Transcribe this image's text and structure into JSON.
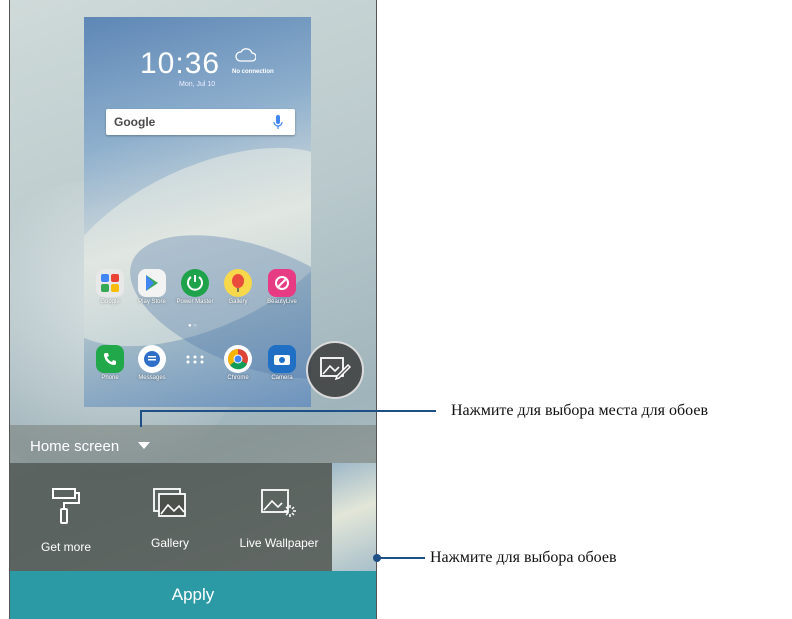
{
  "lockscreen": {
    "time": "10:36",
    "weather_status": "No connection",
    "date": "Mon, Jul 10",
    "search_logo": "Google"
  },
  "apps_row1": [
    {
      "label": "Google",
      "icon": "google-folder-icon"
    },
    {
      "label": "Play Store",
      "icon": "play-store-icon"
    },
    {
      "label": "Power Master",
      "icon": "power-master-icon"
    },
    {
      "label": "Gallery",
      "icon": "gallery-icon"
    },
    {
      "label": "BeautyLive",
      "icon": "beautylive-icon"
    }
  ],
  "apps_row2": [
    {
      "label": "Phone",
      "icon": "phone-icon"
    },
    {
      "label": "Messages",
      "icon": "messages-icon"
    },
    {
      "label": "",
      "icon": "app-drawer-icon"
    },
    {
      "label": "Chrome",
      "icon": "chrome-icon"
    },
    {
      "label": "Camera",
      "icon": "camera-icon"
    }
  ],
  "wallpaper_target": {
    "selected": "Home screen"
  },
  "options": [
    {
      "label": "Get more",
      "icon": "paint-roller-icon"
    },
    {
      "label": "Gallery",
      "icon": "gallery-stack-icon"
    },
    {
      "label": "Live Wallpaper",
      "icon": "live-wallpaper-icon"
    }
  ],
  "apply_label": "Apply",
  "callouts": {
    "location": "Нажмите для выбора места для обоев",
    "wallpaper": "Нажмите для выбора обоев"
  },
  "colors": {
    "accent": "#2c9aa4",
    "callout": "#1e4f86"
  }
}
